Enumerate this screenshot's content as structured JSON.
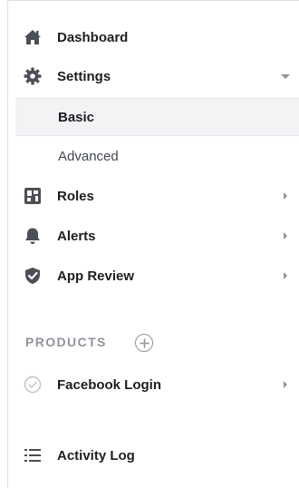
{
  "nav": {
    "dashboard": {
      "label": "Dashboard",
      "icon": "home-icon"
    },
    "settings": {
      "label": "Settings",
      "icon": "gear-icon",
      "expanded": true,
      "children": [
        {
          "label": "Basic",
          "active": true
        },
        {
          "label": "Advanced",
          "active": false
        }
      ]
    },
    "roles": {
      "label": "Roles",
      "icon": "roles-icon"
    },
    "alerts": {
      "label": "Alerts",
      "icon": "bell-icon"
    },
    "app_review": {
      "label": "App Review",
      "icon": "shield-check-icon"
    }
  },
  "products": {
    "title": "PRODUCTS",
    "add_icon": "plus-circle-icon",
    "items": [
      {
        "label": "Facebook Login",
        "icon": "check-circle-icon"
      }
    ]
  },
  "activity_log": {
    "label": "Activity Log",
    "icon": "list-icon"
  },
  "colors": {
    "text": "#1c1e21",
    "muted": "#90949c",
    "active_bg": "#f2f3f5",
    "border": "#dddfe2"
  }
}
